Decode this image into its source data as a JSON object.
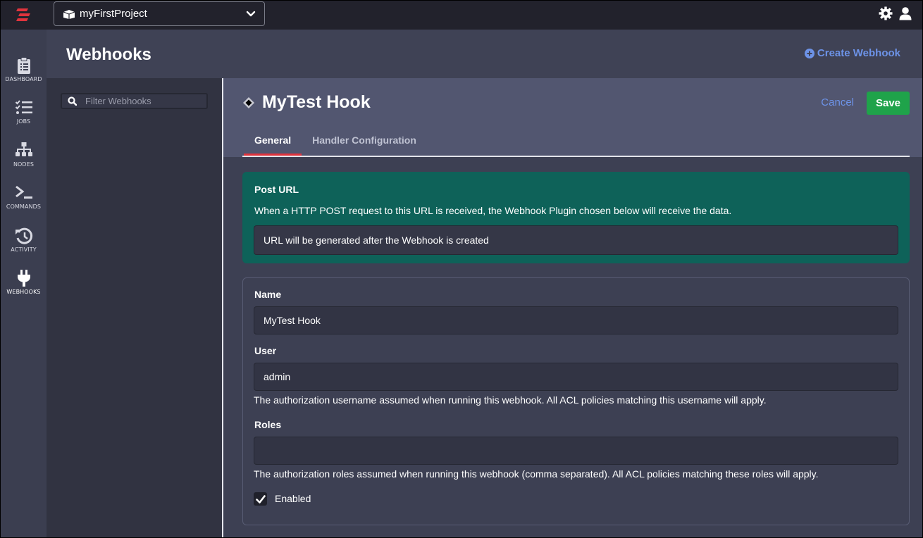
{
  "topbar": {
    "project_name": "myFirstProject",
    "brand_color": "#e0343d"
  },
  "nav": {
    "items": [
      {
        "label": "DASHBOARD",
        "icon": "clipboard-icon"
      },
      {
        "label": "JOBS",
        "icon": "task-list-icon"
      },
      {
        "label": "NODES",
        "icon": "sitemap-icon"
      },
      {
        "label": "COMMANDS",
        "icon": "terminal-icon"
      },
      {
        "label": "ACTIVITY",
        "icon": "history-icon"
      },
      {
        "label": "WEBHOOKS",
        "icon": "plug-icon",
        "active": true
      }
    ]
  },
  "header": {
    "title": "Webhooks",
    "create_label": "Create Webhook"
  },
  "list": {
    "filter_placeholder": "Filter Webhooks",
    "filter_value": ""
  },
  "detail": {
    "title": "MyTest Hook",
    "cancel_label": "Cancel",
    "save_label": "Save",
    "tabs": [
      {
        "label": "General",
        "active": true
      },
      {
        "label": "Handler Configuration",
        "active": false
      }
    ]
  },
  "post_url": {
    "heading": "Post URL",
    "description": "When a HTTP POST request to this URL is received, the Webhook Plugin chosen below will receive the data.",
    "value": "URL will be generated after the Webhook is created"
  },
  "form": {
    "name_label": "Name",
    "name_value": "MyTest Hook",
    "user_label": "User",
    "user_value": "admin",
    "user_help": "The authorization username assumed when running this webhook. All ACL policies matching this username will apply.",
    "roles_label": "Roles",
    "roles_value": "",
    "roles_help": "The authorization roles assumed when running this webhook (comma separated). All ACL policies matching these roles will apply.",
    "enabled_label": "Enabled",
    "enabled": true
  }
}
